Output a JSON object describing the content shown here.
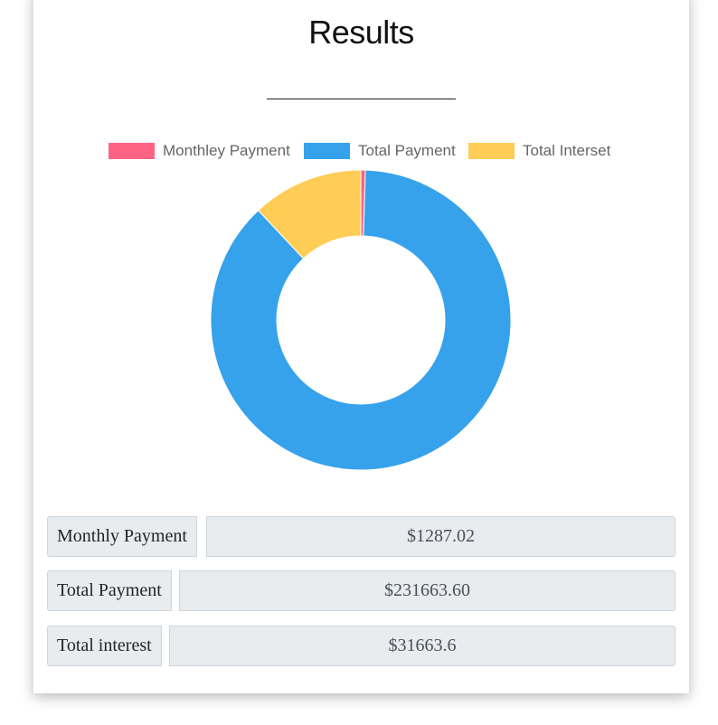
{
  "results": {
    "title": "Results"
  },
  "chart_data": {
    "type": "pie",
    "variant": "doughnut",
    "legend_position": "top",
    "categories": [
      "Monthley Payment",
      "Total Payment",
      "Total Interset"
    ],
    "values": [
      1287.02,
      231663.6,
      31663.6
    ],
    "colors": [
      "#ff6384",
      "#36a2eb",
      "#ffcd56"
    ]
  },
  "rows": [
    {
      "label": "Monthly Payment",
      "value": "$1287.02"
    },
    {
      "label": "Total Payment",
      "value": "$231663.60"
    },
    {
      "label": "Total interest",
      "value": "$31663.6"
    }
  ]
}
